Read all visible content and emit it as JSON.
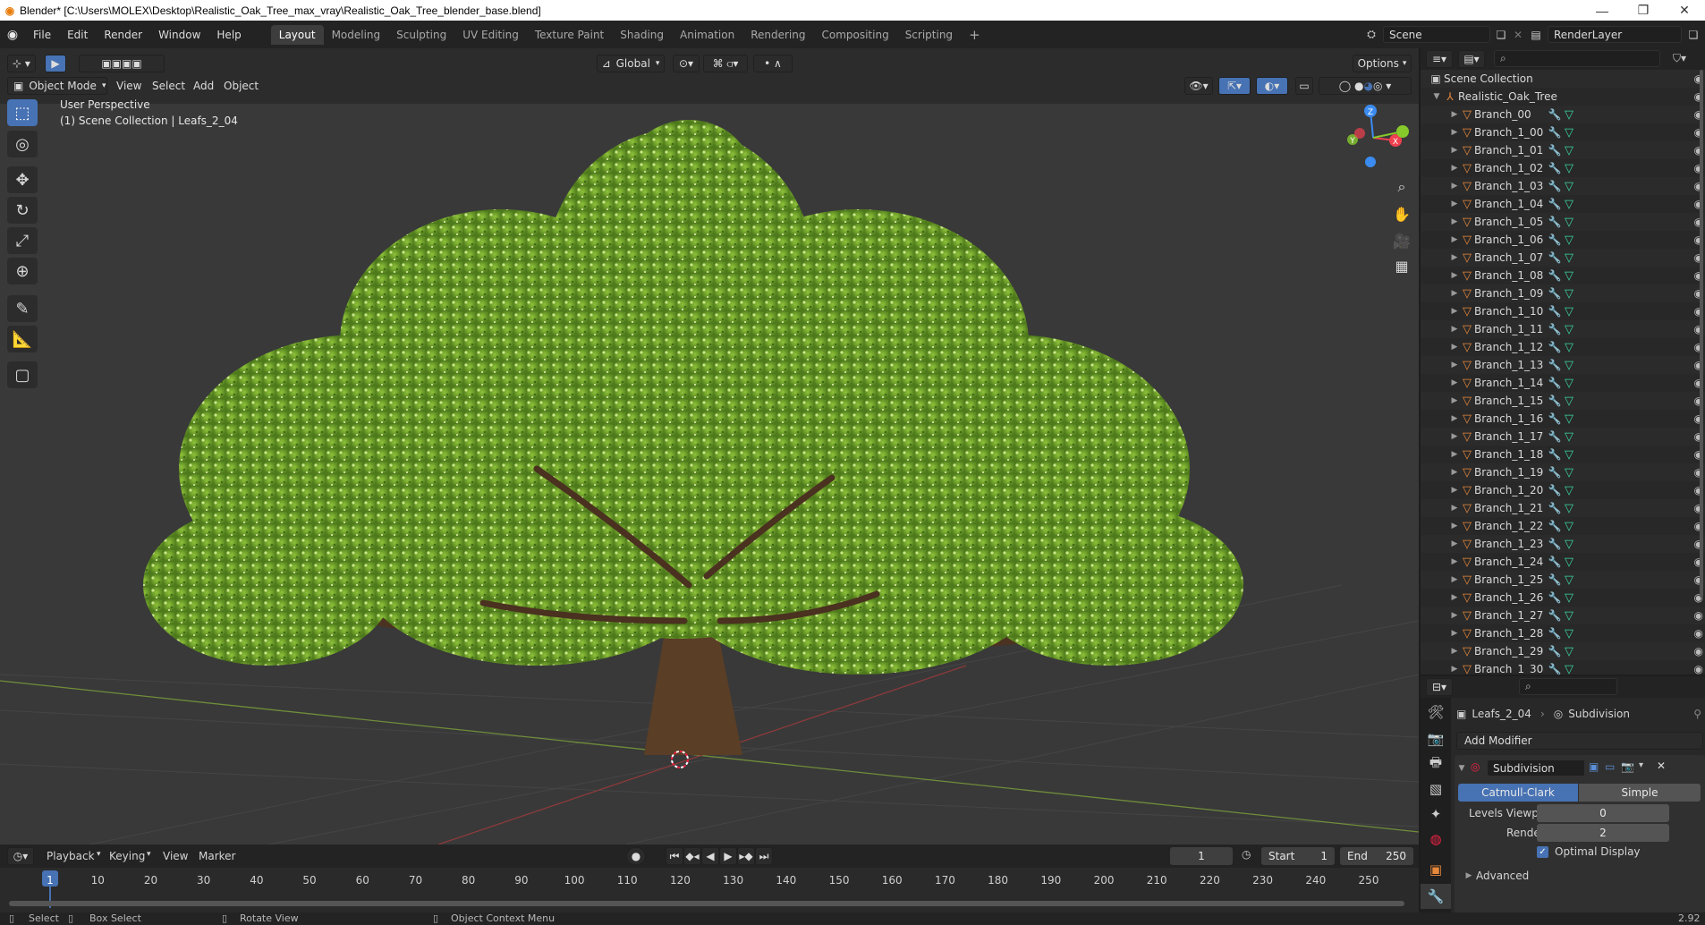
{
  "window": {
    "title": "Blender* [C:\\Users\\MOLEX\\Desktop\\Realistic_Oak_Tree_max_vray\\Realistic_Oak_Tree_blender_base.blend]",
    "minimize": "—",
    "maximize": "❐",
    "close": "✕"
  },
  "menu": {
    "items": [
      "File",
      "Edit",
      "Render",
      "Window",
      "Help"
    ]
  },
  "workspaces": {
    "tabs": [
      "Layout",
      "Modeling",
      "Sculpting",
      "UV Editing",
      "Texture Paint",
      "Shading",
      "Animation",
      "Rendering",
      "Compositing",
      "Scripting"
    ],
    "active": "Layout",
    "add": "+"
  },
  "scene": {
    "name": "Scene",
    "render_layer": "RenderLayer"
  },
  "viewport": {
    "mode": "Object Mode",
    "menus": [
      "View",
      "Select",
      "Add",
      "Object"
    ],
    "transform_orientation": "Global",
    "options_label": "Options",
    "overlay_title": "User Perspective",
    "overlay_subtitle": "(1) Scene Collection | Leafs_2_04",
    "gizmo_axes": {
      "x": "X",
      "y": "Y",
      "z": "Z"
    }
  },
  "colors": {
    "accent": "#4772b3",
    "axis_x": "#f0404f",
    "axis_y": "#86c92b",
    "axis_z": "#3b8bf0",
    "mesh_orange": "#e8883a",
    "modifier_blue": "#5a8fd8",
    "mesh_data_teal": "#3bd6a4"
  },
  "outliner": {
    "root": "Scene Collection",
    "collection": "Realistic_Oak_Tree",
    "items": [
      "Branch_00",
      "Branch_1_00",
      "Branch_1_01",
      "Branch_1_02",
      "Branch_1_03",
      "Branch_1_04",
      "Branch_1_05",
      "Branch_1_06",
      "Branch_1_07",
      "Branch_1_08",
      "Branch_1_09",
      "Branch_1_10",
      "Branch_1_11",
      "Branch_1_12",
      "Branch_1_13",
      "Branch_1_14",
      "Branch_1_15",
      "Branch_1_16",
      "Branch_1_17",
      "Branch_1_18",
      "Branch_1_19",
      "Branch_1_20",
      "Branch_1_21",
      "Branch_1_22",
      "Branch_1_23",
      "Branch_1_24",
      "Branch_1_25",
      "Branch_1_26",
      "Branch_1_27",
      "Branch_1_28",
      "Branch_1_29",
      "Branch_1_30"
    ]
  },
  "properties": {
    "object_name": "Leafs_2_04",
    "modifier_context": "Subdivision",
    "add_modifier": "Add Modifier",
    "modifier": {
      "name": "Subdivision",
      "type_catmull": "Catmull-Clark",
      "type_simple": "Simple",
      "levels_viewport_label": "Levels Viewport",
      "levels_viewport": "0",
      "render_label": "Render",
      "render": "2",
      "optimal_display_label": "Optimal Display",
      "optimal_display": true,
      "advanced": "Advanced"
    }
  },
  "timeline": {
    "menus": [
      "Playback",
      "Keying",
      "View",
      "Marker"
    ],
    "current_frame": "1",
    "start_label": "Start",
    "start": "1",
    "end_label": "End",
    "end": "250",
    "ticks": [
      "1",
      "10",
      "20",
      "30",
      "40",
      "50",
      "60",
      "70",
      "80",
      "90",
      "100",
      "110",
      "120",
      "130",
      "140",
      "150",
      "160",
      "170",
      "180",
      "190",
      "200",
      "210",
      "220",
      "230",
      "240",
      "250"
    ]
  },
  "status": {
    "select": "Select",
    "box_select": "Box Select",
    "rotate_view": "Rotate View",
    "context_menu": "Object Context Menu",
    "version": "2.92"
  }
}
